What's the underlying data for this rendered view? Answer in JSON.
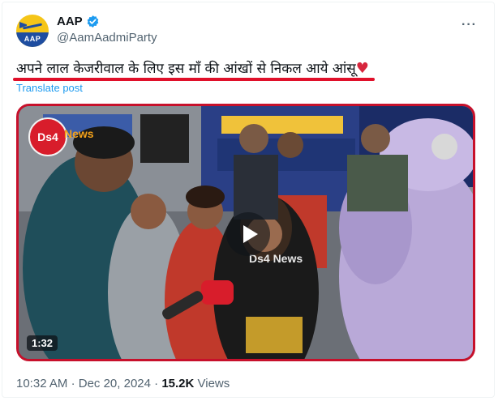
{
  "author": {
    "display_name": "AAP",
    "handle": "@AamAadmiParty",
    "avatar_text": "AAP",
    "verified": true,
    "verified_color": "#1d9bf0"
  },
  "menu": {
    "more_label": "···"
  },
  "post": {
    "text": "अपने लाल केजरीवाल के लिए इस माँ की आंखों से निकल आये आंसू",
    "emoji": "♥",
    "translate_label": "Translate post"
  },
  "video": {
    "brand_badge": "Ds4",
    "brand_news": "News",
    "watermark": "Ds4 News",
    "duration": "1:32",
    "border_color": "#c7102b"
  },
  "meta": {
    "time": "10:32 AM",
    "separator": "·",
    "date": "Dec 20, 2024",
    "views_count": "15.2K",
    "views_label": "Views"
  },
  "colors": {
    "link": "#1d9bf0",
    "secondary_text": "#536471",
    "underline": "#e0102a"
  }
}
